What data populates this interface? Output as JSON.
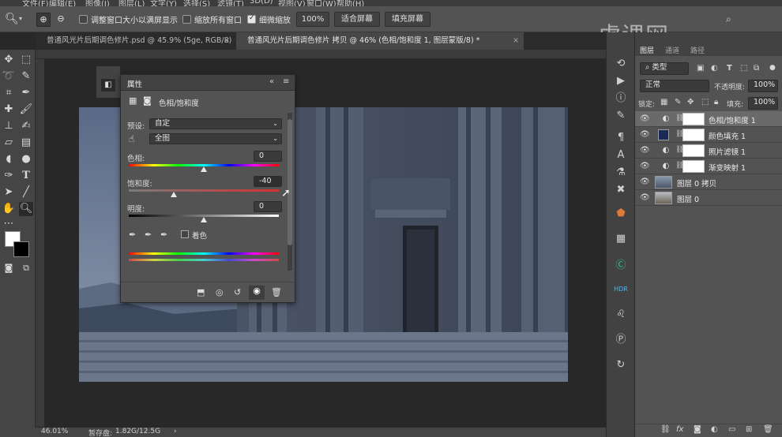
{
  "menu": {
    "items": [
      "文件(F)",
      "编辑(E)",
      "图像(I)",
      "图层(L)",
      "文字(Y)",
      "选择(S)",
      "滤镜(T)",
      "3D(D)",
      "视图(V)",
      "窗口(W)",
      "帮助(H)"
    ]
  },
  "options_bar": {
    "zoom_in_icon": "zoom-in",
    "zoom_out_icon": "zoom-out",
    "resize_windows_label": "调整窗口大小以满屏显示",
    "resize_windows_checked": false,
    "zoom_all_label": "缩放所有窗口",
    "zoom_all_checked": false,
    "scrubby_label": "细微缩放",
    "scrubby_checked": true,
    "zoom_value": "100%",
    "fit_screen_label": "适合屏幕",
    "fill_screen_label": "填充屏幕"
  },
  "tabs": [
    {
      "label": "普通风光片后期调色修片.psd @ 45.9% (5ge, RGB/8) *",
      "active": false
    },
    {
      "label": "普通风光片后期调色修片 拷贝 @ 46% (色相/饱和度 1, 图层蒙版/8) *",
      "active": true
    }
  ],
  "watermark": "虎课网",
  "properties": {
    "title": "属性",
    "adjustment_name": "色相/饱和度",
    "preset_label": "预设:",
    "preset_value": "自定",
    "channel_value": "全图",
    "hue_label": "色相:",
    "hue_value": "0",
    "hue_fraction": 0.5,
    "saturation_label": "饱和度:",
    "saturation_value": "-40",
    "saturation_fraction": 0.3,
    "lightness_label": "明度:",
    "lightness_value": "0",
    "lightness_fraction": 0.5,
    "colorize_label": "着色",
    "colorize_checked": false
  },
  "layers_panel": {
    "tabs": [
      "图层",
      "通道",
      "路径"
    ],
    "filter_label": "类型",
    "blend_mode": "正常",
    "opacity_label": "不透明度:",
    "opacity_value": "100%",
    "lock_label": "锁定:",
    "fill_label": "填充:",
    "fill_value": "100%",
    "layers": [
      {
        "name": "色相/饱和度 1",
        "kind": "adjustment",
        "selected": true
      },
      {
        "name": "颜色填充 1",
        "kind": "fill",
        "selected": false
      },
      {
        "name": "照片滤镜 1",
        "kind": "adjustment",
        "selected": false
      },
      {
        "name": "渐变映射 1",
        "kind": "adjustment",
        "selected": false
      },
      {
        "name": "图层 0 拷贝",
        "kind": "pixel",
        "selected": false
      },
      {
        "name": "图层 0",
        "kind": "pixel",
        "selected": false
      }
    ]
  },
  "status": {
    "zoom": "46.01%",
    "doc_label": "暂存盘:",
    "doc_value": "1.82G/12.5G"
  },
  "colors": {
    "panel_bg": "#535353",
    "toolbar_bg": "#454545",
    "workspace_bg": "#282828",
    "selected_row": "#6a6a6a",
    "fill_swatch": "#1c2a5a"
  }
}
